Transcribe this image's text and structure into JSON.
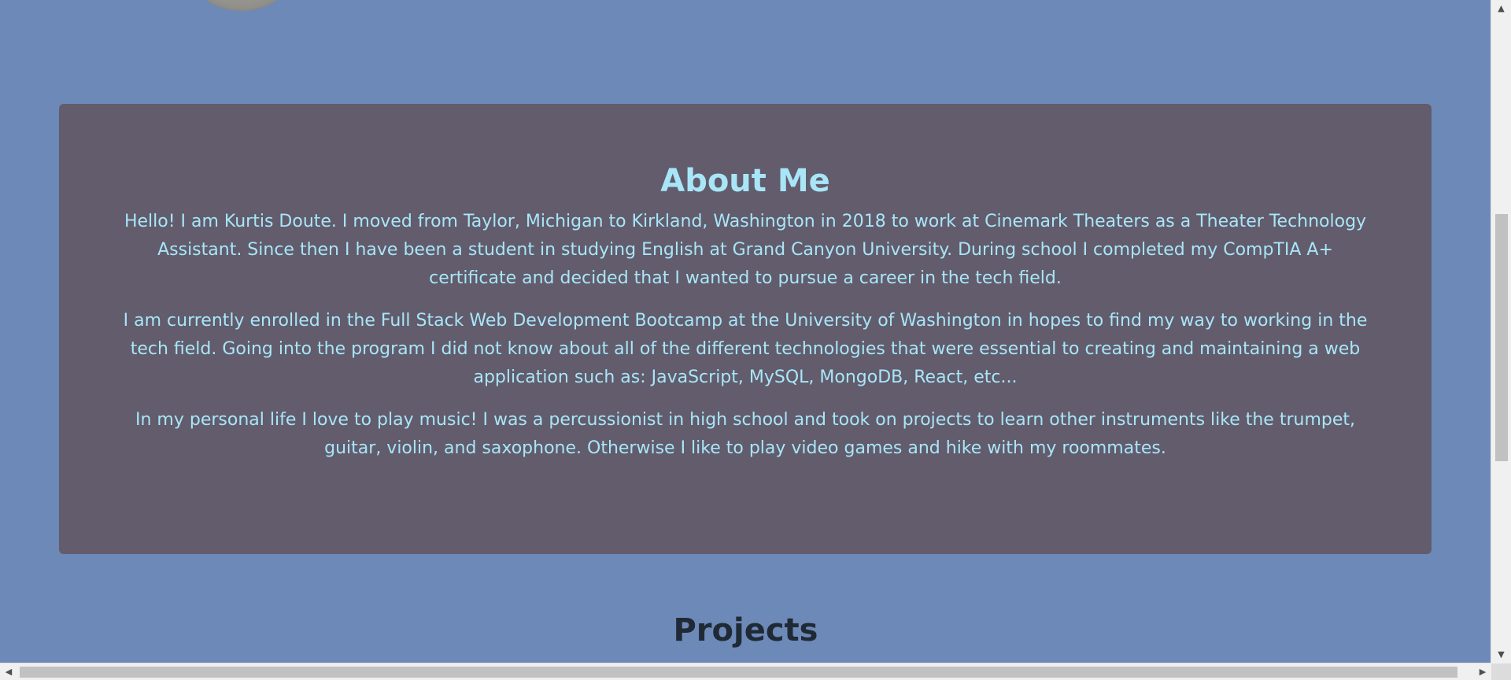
{
  "about": {
    "title": "About Me",
    "paragraphs": [
      "Hello! I am Kurtis Doute. I moved from Taylor, Michigan to Kirkland, Washington in 2018 to work at Cinemark Theaters as a Theater Technology Assistant. Since then I have been a student in studying English at Grand Canyon University. During school I completed my CompTIA A+ certificate and decided that I wanted to pursue a career in the tech field.",
      "I am currently enrolled in the Full Stack Web Development Bootcamp at the University of Washington in hopes to find my way to working in the tech field. Going into the program I did not know about all of the different technologies that were essential to creating and maintaining a web application such as: JavaScript, MySQL, MongoDB, React, etc...",
      "In my personal life I love to play music! I was a percussionist in high school and took on projects to learn other instruments like the trumpet, guitar, violin, and saxophone. Otherwise I like to play video games and hike with my roommates."
    ]
  },
  "projects": {
    "title": "Projects"
  },
  "scrollbars": {
    "up_arrow": "▲",
    "down_arrow": "▼",
    "left_arrow": "◀",
    "right_arrow": "▶"
  },
  "colors": {
    "page_background": "#6d89b7",
    "card_background": "#625c6d",
    "accent_text": "#a8e6f7",
    "heading_dark": "#1f2a36"
  }
}
